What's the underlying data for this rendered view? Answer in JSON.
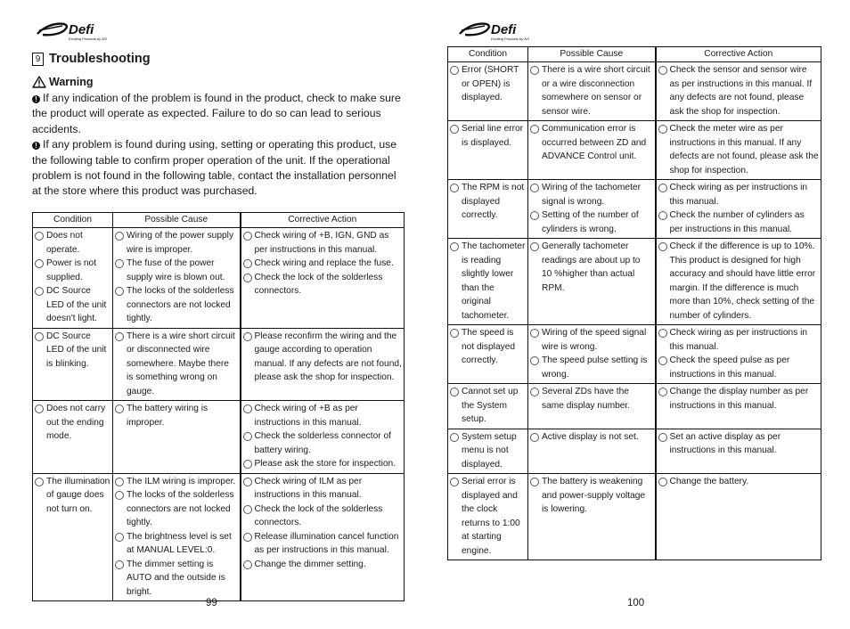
{
  "brand": {
    "logo_text": "Defi",
    "tagline": "Exciting Products by NS"
  },
  "left_page": {
    "section_number": "9",
    "section_title": "Troubleshooting",
    "warning_label": "Warning",
    "warnings": [
      "If any indication of the problem is found in the product, check to make sure the product will operate as expected. Failure to do so can lead to serious accidents.",
      "If any problem is found during using, setting or operating this product,  use the following table to confirm proper operation of the unit.  If the operational problem is not found in the following table, contact the installation personnel at the store where this product was purchased."
    ],
    "page_number": "99"
  },
  "right_page": {
    "page_number": "100"
  },
  "table_headers": {
    "condition": "Condition",
    "cause": "Possible Cause",
    "action": "Corrective Action"
  },
  "left_table_rows": [
    {
      "conditions": [
        "Does not operate.",
        "Power is not supplied.",
        "DC Source LED of the unit doesn't light."
      ],
      "causes": [
        "Wiring of the power supply wire is improper.",
        "The fuse of the power supply wire is blown out.",
        "The locks of the solderless connectors are not locked tightly."
      ],
      "actions": [
        "Check wiring of +B, IGN, GND as per instructions in this manual.",
        "Check wiring and replace the fuse.",
        "Check the lock of the solderless connectors."
      ]
    },
    {
      "conditions": [
        "DC Source LED of the unit is blinking."
      ],
      "causes": [
        "There is a wire short circuit or disconnected wire somewhere. Maybe there is something wrong on gauge."
      ],
      "actions": [
        "Please reconfirm the wiring and the gauge according to operation manual. If any defects are not found, please ask the shop for inspection."
      ]
    },
    {
      "conditions": [
        "Does not carry out the ending mode."
      ],
      "causes": [
        "The battery wiring is improper."
      ],
      "actions": [
        "Check wiring of +B as per instructions in this manual.",
        "Check the solderless connector of battery wiring.",
        "Please ask the store for inspection."
      ]
    },
    {
      "conditions": [
        "The illumination of gauge does not turn on."
      ],
      "causes": [
        "The ILM wiring is improper.",
        "The locks of the solderless connectors are not locked tightly.",
        "The brightness level is set at MANUAL LEVEL:0.",
        "The dimmer setting is AUTO and the outside is bright."
      ],
      "actions": [
        "Check wiring of ILM as per instructions in this manual.",
        "Check the lock of the solderless connectors.",
        "Release illumination cancel function as per instructions in this manual.",
        "Change the dimmer setting."
      ]
    }
  ],
  "right_table_rows": [
    {
      "conditions": [
        "Error  (SHORT or OPEN) is displayed."
      ],
      "causes": [
        "There is a wire short circuit or a wire disconnection somewhere on sensor or sensor wire."
      ],
      "actions": [
        "Check the sensor and sensor wire as per instructions in this manual.  If any defects are not found, please ask the shop for inspection."
      ]
    },
    {
      "conditions": [
        "Serial line error is displayed."
      ],
      "causes": [
        "Communication error is occurred between ZD and ADVANCE Control unit."
      ],
      "actions": [
        "Check the meter wire as per instructions in this manual.  If any defects are not found, please ask the shop for inspection."
      ]
    },
    {
      "conditions": [
        "The RPM is not displayed correctly."
      ],
      "causes": [
        "Wiring of the tachometer signal is wrong.",
        "Setting of the number of cylinders is wrong."
      ],
      "actions": [
        "Check wiring as per instructions in this manual.",
        "Check the number of cylinders as per instructions in this manual."
      ]
    },
    {
      "conditions": [
        "The tachometer is reading slightly lower than the original tachometer."
      ],
      "causes": [
        "Generally tachometer readings are about up to 10 %higher than actual RPM."
      ],
      "actions": [
        "Check if the difference is up to 10%. This product is designed for high accuracy and should have little error margin.  If the difference is much more than 10%, check setting of the number of cylinders."
      ]
    },
    {
      "conditions": [
        "The speed is not displayed correctly."
      ],
      "causes": [
        "Wiring of the speed signal wire is wrong.",
        "The speed pulse setting is wrong."
      ],
      "actions": [
        "Check wiring as per instructions in this manual.",
        "Check the speed pulse as per instructions in this manual."
      ]
    },
    {
      "conditions": [
        "Cannot set up the System setup."
      ],
      "causes": [
        "Several ZDs have the same display number."
      ],
      "actions": [
        "Change the display number as per instructions in this manual."
      ]
    },
    {
      "conditions": [
        "System setup menu is not displayed."
      ],
      "causes": [
        "Active display is not set."
      ],
      "actions": [
        "Set an active display as per instructions in this manual."
      ]
    },
    {
      "conditions": [
        "Serial error is displayed and the clock returns to 1:00 at starting engine."
      ],
      "causes": [
        "The battery is weakening and power-supply voltage is lowering."
      ],
      "actions": [
        "Change the battery."
      ]
    }
  ]
}
